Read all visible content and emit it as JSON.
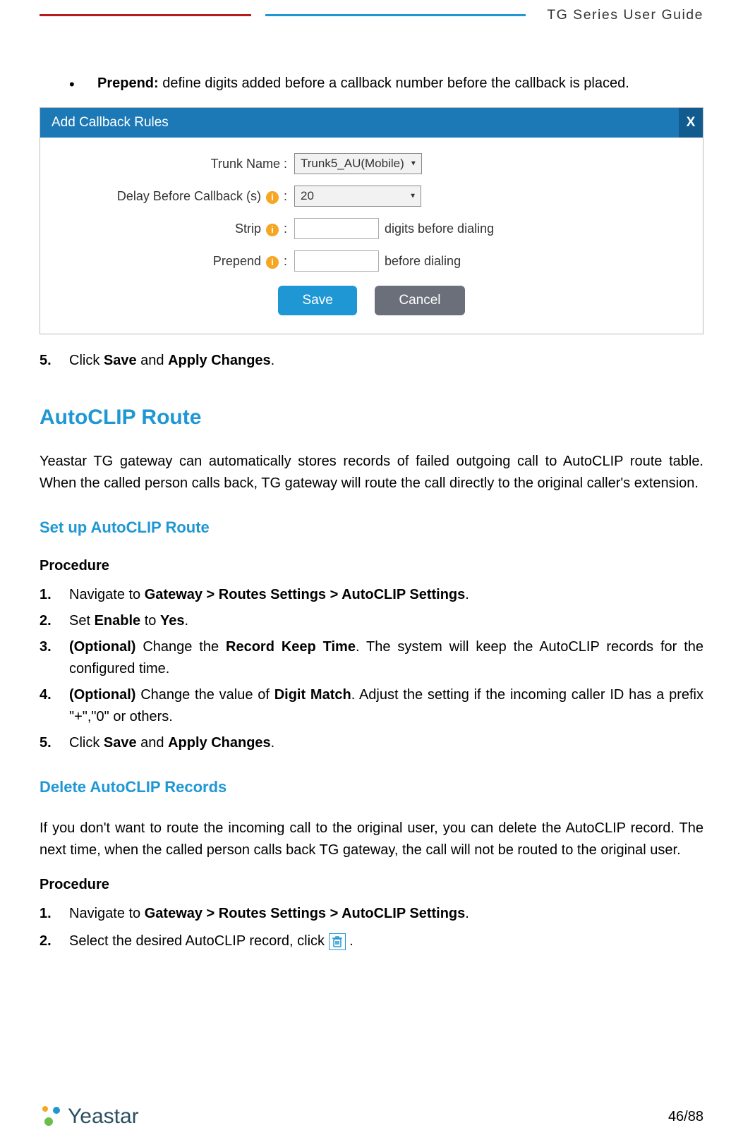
{
  "header": {
    "title": "TG  Series  User  Guide"
  },
  "bullet": {
    "label": "Prepend:",
    "text": " define digits added before a callback number before the callback is placed."
  },
  "modal": {
    "title": "Add Callback Rules",
    "close": "X",
    "fields": {
      "trunk_label": "Trunk Name :",
      "trunk_value": "Trunk5_AU(Mobile)",
      "delay_label_pre": "Delay Before Callback (s) ",
      "delay_label_post": " :",
      "delay_value": "20",
      "strip_label_pre": "Strip ",
      "strip_label_post": " :",
      "strip_after": "digits before dialing",
      "prepend_label_pre": "Prepend ",
      "prepend_label_post": " :",
      "prepend_after": "before dialing"
    },
    "save": "Save",
    "cancel": "Cancel"
  },
  "step5": {
    "num": "5.",
    "pre": "Click ",
    "b1": "Save",
    "mid": " and ",
    "b2": "Apply Changes",
    "post": "."
  },
  "sections": {
    "autoclip_title": "AutoCLIP Route",
    "autoclip_intro": "Yeastar TG gateway can automatically stores records of failed outgoing call to AutoCLIP route table. When the called person calls back, TG gateway will route the call directly to the original caller's extension.",
    "setup_title": "Set up AutoCLIP Route",
    "procedure_label": "Procedure",
    "setup_steps": {
      "s1_num": "1.",
      "s1_pre": "Navigate to ",
      "s1_b": "Gateway > Routes Settings > AutoCLIP Settings",
      "s1_post": ".",
      "s2_num": "2.",
      "s2_pre": "Set ",
      "s2_b1": "Enable",
      "s2_mid": " to ",
      "s2_b2": "Yes",
      "s2_post": ".",
      "s3_num": "3.",
      "s3_b1": "(Optional)",
      "s3_mid1": " Change the ",
      "s3_b2": "Record Keep Time",
      "s3_post": ". The system will keep the AutoCLIP records for the configured time.",
      "s4_num": "4.",
      "s4_b1": "(Optional)",
      "s4_mid1": " Change the value of ",
      "s4_b2": "Digit Match",
      "s4_post": ". Adjust the setting if the incoming caller ID has a prefix \"+\",\"0\" or others.",
      "s5_num": "5.",
      "s5_pre": "Click ",
      "s5_b1": "Save",
      "s5_mid": " and ",
      "s5_b2": "Apply Changes",
      "s5_post": "."
    },
    "delete_title": "Delete AutoCLIP Records",
    "delete_intro": "If you don't want to route the incoming call to the original user, you can delete the AutoCLIP record. The next time, when the called person calls back TG gateway, the call will not be routed to the original user.",
    "delete_steps": {
      "d1_num": "1.",
      "d1_pre": "Navigate to ",
      "d1_b": "Gateway > Routes Settings > AutoCLIP Settings",
      "d1_post": ".",
      "d2_num": "2.",
      "d2_pre": "Select the desired AutoCLIP record, click ",
      "d2_post": "."
    }
  },
  "footer": {
    "brand": "Yeastar",
    "page": "46/88"
  }
}
